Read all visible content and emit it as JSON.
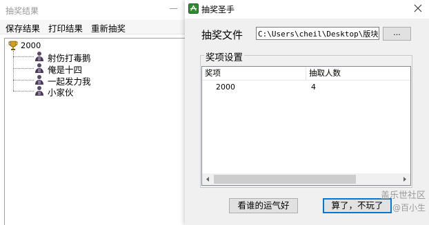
{
  "results_window": {
    "title": "抽奖结果",
    "menu": [
      {
        "label": "保存结果"
      },
      {
        "label": "打印结果"
      },
      {
        "label": "重新抽奖"
      }
    ],
    "tree": {
      "root_label": "2000",
      "children": [
        {
          "label": "射伤打毒鹅"
        },
        {
          "label": "俺是十四"
        },
        {
          "label": "一起发力我"
        },
        {
          "label": "小家伙"
        }
      ]
    }
  },
  "dialog": {
    "title": "抽奖圣手",
    "file_label": "抽奖文件",
    "file_path": "C:\\Users\\cheil\\Desktop\\版块活",
    "browse_label": "...",
    "group_label": "奖项设置",
    "columns": [
      "奖项",
      "抽取人数"
    ],
    "rows": [
      {
        "prize": "2000",
        "count": "4"
      }
    ],
    "buttons": {
      "lucky": "看谁的运气好",
      "cancel": "算了，不玩了"
    }
  },
  "watermark": {
    "line1": "盖乐世社区",
    "line2": "@百小生"
  },
  "colors": {
    "dialog_bg": "#f0f0f0",
    "focus_blue": "#0078d7",
    "app_icon_green": "#2e8b2e",
    "trophy_gold": "#d4a017"
  }
}
